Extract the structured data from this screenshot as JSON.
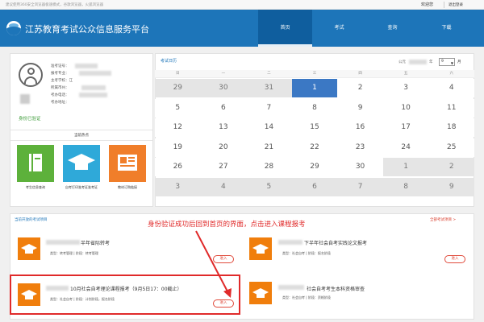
{
  "topbar": {
    "notice": "建议使用360安全浏览器极速模式，谷歌浏览器，火狐浏览器",
    "welcome": "欢迎您",
    "logout": "退出登录"
  },
  "header": {
    "title": "江苏教育考试公众信息服务平台"
  },
  "nav": [
    {
      "label": "首页",
      "active": true
    },
    {
      "label": "考试"
    },
    {
      "label": "查询"
    },
    {
      "label": "下载"
    }
  ],
  "profile": {
    "fields": [
      {
        "label": "准考证号：",
        "value": ""
      },
      {
        "label": "报考专业：",
        "value": ""
      },
      {
        "label": "主考学校：",
        "value": "江"
      },
      {
        "label": "所属市州：",
        "value": ""
      },
      {
        "label": "考办电话：",
        "value": ""
      },
      {
        "label": "考办地址：",
        "value": ""
      }
    ],
    "verified": "身份已验证"
  },
  "hot": {
    "title": "当前热点",
    "items": [
      {
        "label": "考生信息查询",
        "color": "#5db13b",
        "icon": "book-icon"
      },
      {
        "label": "自考打印准考证准考证",
        "color": "#2fa9d9",
        "icon": "graduation-cap-icon"
      },
      {
        "label": "教材订购链接",
        "color": "#f07e2a",
        "icon": "newspaper-icon"
      }
    ]
  },
  "calendar": {
    "title": "考试日历",
    "year_label": "公元",
    "year_suffix": "年",
    "month_value": "9",
    "month_label": "月",
    "weekdays": [
      "日",
      "一",
      "二",
      "三",
      "四",
      "五",
      "六"
    ],
    "today": 1,
    "weeks": [
      [
        {
          "d": "29",
          "other": true
        },
        {
          "d": "30",
          "other": true
        },
        {
          "d": "31",
          "other": true
        },
        {
          "d": "1"
        },
        {
          "d": "2"
        },
        {
          "d": "3"
        },
        {
          "d": "4"
        }
      ],
      [
        {
          "d": "5"
        },
        {
          "d": "6"
        },
        {
          "d": "7"
        },
        {
          "d": "8"
        },
        {
          "d": "9"
        },
        {
          "d": "10"
        },
        {
          "d": "11"
        }
      ],
      [
        {
          "d": "12"
        },
        {
          "d": "13"
        },
        {
          "d": "14"
        },
        {
          "d": "15"
        },
        {
          "d": "16"
        },
        {
          "d": "17"
        },
        {
          "d": "18"
        }
      ],
      [
        {
          "d": "19"
        },
        {
          "d": "20"
        },
        {
          "d": "21"
        },
        {
          "d": "22"
        },
        {
          "d": "23"
        },
        {
          "d": "24"
        },
        {
          "d": "25"
        }
      ],
      [
        {
          "d": "26"
        },
        {
          "d": "27"
        },
        {
          "d": "28"
        },
        {
          "d": "29"
        },
        {
          "d": "30"
        },
        {
          "d": "1",
          "other": true
        },
        {
          "d": "2",
          "other": true
        }
      ],
      [
        {
          "d": "3",
          "other": true
        },
        {
          "d": "4",
          "other": true
        },
        {
          "d": "5",
          "other": true
        },
        {
          "d": "6",
          "other": true
        },
        {
          "d": "7",
          "other": true
        },
        {
          "d": "8",
          "other": true
        },
        {
          "d": "9",
          "other": true
        }
      ]
    ]
  },
  "exams": {
    "title": "当前开放的考试项目",
    "all_link": "全部考试项目 >",
    "annotation": "身份验证成功后回到首页的界面，点击进入课程报考",
    "items": [
      {
        "title": "半年省际转考",
        "meta": "类型：转考管理 | 阶段：转考管理",
        "button": "进入"
      },
      {
        "title": "下半年社会自考实践论文报考",
        "meta": "类型：社会自考 | 阶段：报名阶段",
        "button": "进入"
      },
      {
        "title": "10月社会自考理论课程报考（9月5日17：00截止）",
        "meta": "类型：社会自考 | 阶段：计划阶段，报名阶段",
        "button": "进入"
      },
      {
        "title": "社会自考考生本科资格审查",
        "meta": "类型：社会自考 | 阶段：资格阶段",
        "button": "进入"
      }
    ]
  }
}
